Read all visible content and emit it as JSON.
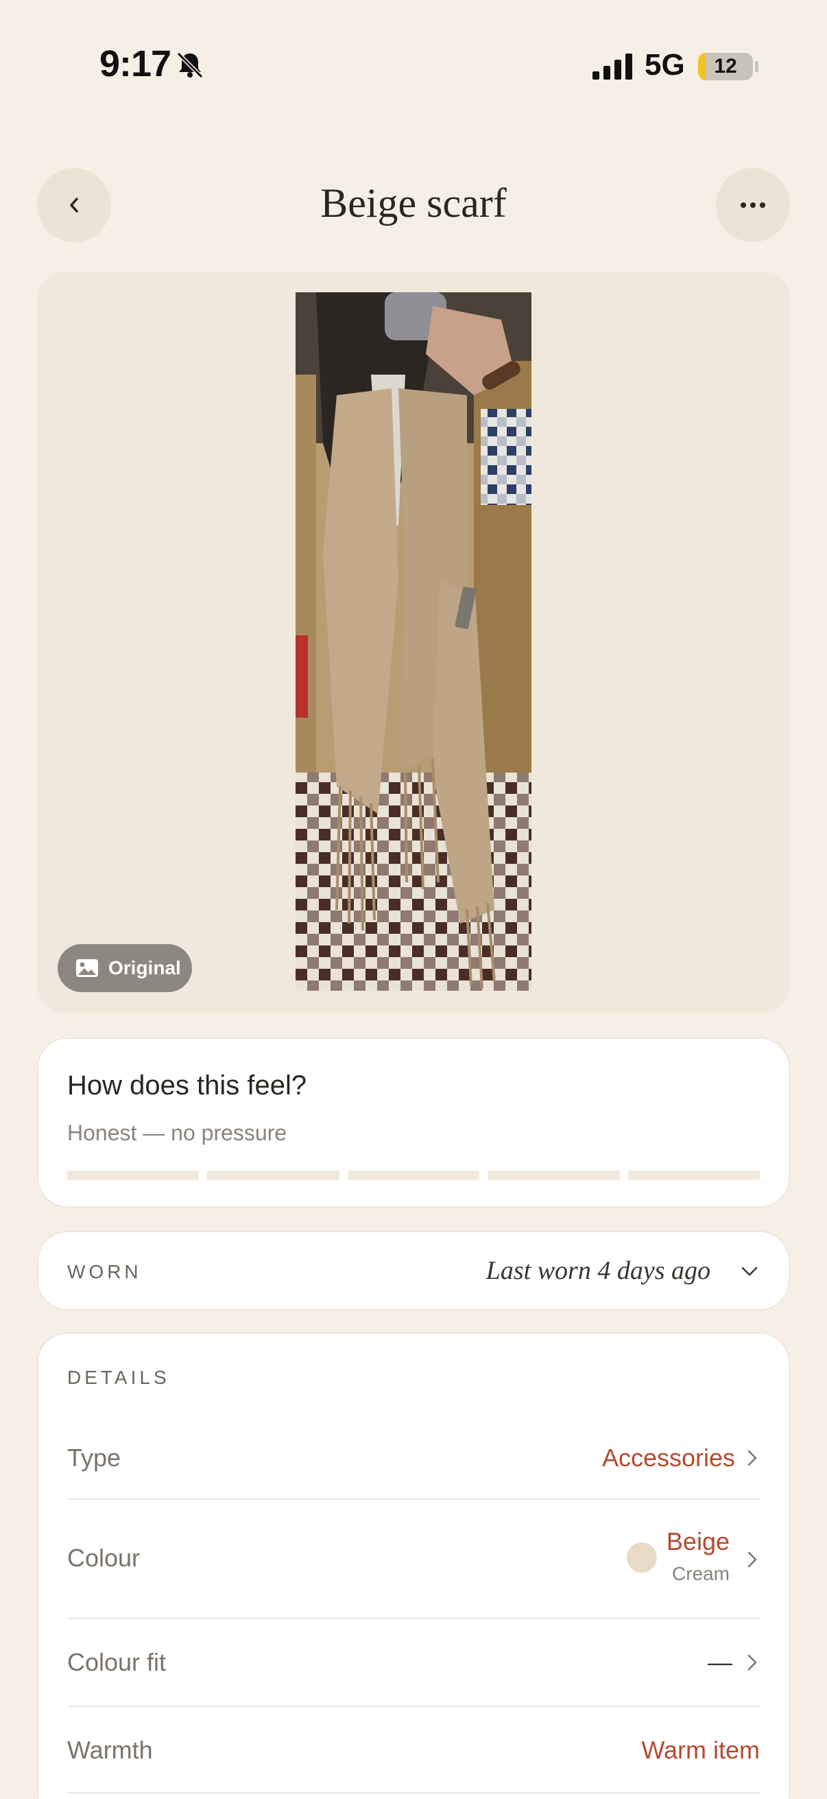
{
  "status_bar": {
    "time": "9:17",
    "network": "5G",
    "battery_level": "12",
    "battery_fraction": 0.12
  },
  "header": {
    "title": "Beige scarf",
    "back_icon": "chevron-left-icon",
    "more_icon": "ellipsis-icon"
  },
  "photo": {
    "badge_label": "Original",
    "badge_icon": "image-icon"
  },
  "feel": {
    "title": "How does this feel?",
    "subtitle": "Honest — no pressure",
    "segments": 5,
    "selected": 0
  },
  "worn": {
    "label": "WORN",
    "value": "Last worn 4 days ago"
  },
  "details": {
    "label": "DETAILS",
    "type": {
      "key": "Type",
      "value": "Accessories"
    },
    "colour": {
      "key": "Colour",
      "value": "Beige",
      "sub": "Cream",
      "swatch": "#e8dac7"
    },
    "colour_fit": {
      "key": "Colour fit",
      "value": "—"
    },
    "warmth": {
      "key": "Warmth",
      "value": "Warm item"
    }
  },
  "colors": {
    "background": "#f5efe6",
    "accent": "#b54a2e",
    "card": "#ffffff"
  }
}
